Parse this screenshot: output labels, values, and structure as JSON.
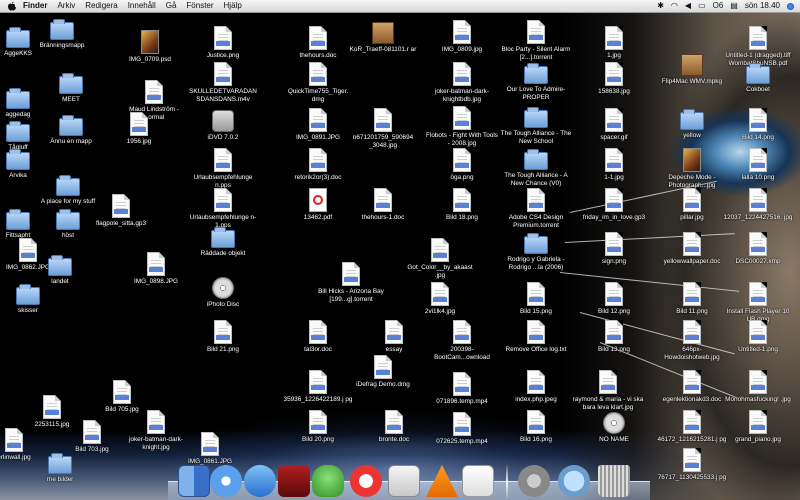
{
  "menubar": {
    "apple": "apple-icon",
    "items": [
      "Finder",
      "Arkiv",
      "Redigera",
      "Innehåll",
      "Gå",
      "Fönster",
      "Hjälp"
    ],
    "status": {
      "number": "O6",
      "clock": "sön 18.40"
    }
  },
  "icons": [
    {
      "label": "AggeKKS",
      "kind": "folder"
    },
    {
      "label": "Bränningsmapp",
      "kind": "folder"
    },
    {
      "label": "IMG_0709.psd",
      "kind": "image"
    },
    {
      "label": "aggedag",
      "kind": "folder"
    },
    {
      "label": "MEET",
      "kind": "folder"
    },
    {
      "label": "Maud Lindström - Normal",
      "kind": "document"
    },
    {
      "label": "Tågluff",
      "kind": "folder"
    },
    {
      "label": "Ännu en mapp",
      "kind": "folder"
    },
    {
      "label": "1956.jpg",
      "kind": "document"
    },
    {
      "label": "Arvika",
      "kind": "folder"
    },
    {
      "label": "A place for my stuff",
      "kind": "folder"
    },
    {
      "label": "Fittsapht",
      "kind": "folder"
    },
    {
      "label": "höst",
      "kind": "folder"
    },
    {
      "label": "flagpole_sitta.gp3",
      "kind": "document"
    },
    {
      "label": "IMG_0862.JPG",
      "kind": "document"
    },
    {
      "label": "landet",
      "kind": "folder"
    },
    {
      "label": "IMG_0898.JPG",
      "kind": "document"
    },
    {
      "label": "skisser",
      "kind": "folder"
    },
    {
      "label": "Justice.png",
      "kind": "document"
    },
    {
      "label": "SKULLEDETVARADAN SDANSDANS.m4v",
      "kind": "document"
    },
    {
      "label": "iDVD 7.0.2",
      "kind": "app"
    },
    {
      "label": "Urlaubsempfehlunge n.pps",
      "kind": "document"
    },
    {
      "label": "Urlaubsempfehlunge n-1.pps",
      "kind": "document"
    },
    {
      "label": "Räddade objekt",
      "kind": "folder"
    },
    {
      "label": "iPhoto Disc",
      "kind": "disc"
    },
    {
      "label": "Bild 21.png",
      "kind": "document"
    },
    {
      "label": "thehours.doc",
      "kind": "document"
    },
    {
      "label": "QuickTime755_Tiger. dmg",
      "kind": "document"
    },
    {
      "label": "IMG_0891.JPG",
      "kind": "document"
    },
    {
      "label": "retorik2or(3).doc",
      "kind": "document"
    },
    {
      "label": "13462.pdf",
      "kind": "pdf"
    },
    {
      "label": "KoR_Traeff-081101.r ar",
      "kind": "box"
    },
    {
      "label": "n671201759_590694 _3048.jpg",
      "kind": "document"
    },
    {
      "label": "thehours-1.doc",
      "kind": "document"
    },
    {
      "label": "Bill Hicks - Arizona Bay [199...g].torrent",
      "kind": "document"
    },
    {
      "label": "tal3or.doc",
      "kind": "document"
    },
    {
      "label": "essay",
      "kind": "document"
    },
    {
      "label": "35936_1226422189.j pg",
      "kind": "document"
    },
    {
      "label": "Bild 20.png",
      "kind": "document"
    },
    {
      "label": "IMG_0809.jpg",
      "kind": "document"
    },
    {
      "label": "joker-batman-dark- knightbdb.jpg",
      "kind": "document"
    },
    {
      "label": "Flobots - Fight With Tools - 2008.jpg",
      "kind": "document"
    },
    {
      "label": "öga.png",
      "kind": "document"
    },
    {
      "label": "Bild 18.png",
      "kind": "document"
    },
    {
      "label": "Got_Color__by_akaast .jpg",
      "kind": "document"
    },
    {
      "label": "2vi1lk4.jpg",
      "kind": "document"
    },
    {
      "label": "200398- BootCam...ownload",
      "kind": "document"
    },
    {
      "label": "iDefrag Demo.dmg",
      "kind": "document"
    },
    {
      "label": "bronte.doc",
      "kind": "document"
    },
    {
      "label": "071896.temp.mp4",
      "kind": "document"
    },
    {
      "label": "072625.temp.mp4",
      "kind": "document"
    },
    {
      "label": "Bloc Party - Silent Alarm [2...].torrent",
      "kind": "document"
    },
    {
      "label": "Our Love To Admire- PROPER",
      "kind": "folder"
    },
    {
      "label": "The Tough Alliance - The New School",
      "kind": "folder"
    },
    {
      "label": "The Tough Alliance - A New Chance (V0)",
      "kind": "folder"
    },
    {
      "label": "Adobe CS4 Design Premium.torrent",
      "kind": "document"
    },
    {
      "label": "Rodrigo y Gabriela - Rodrigo ...la (2006)",
      "kind": "folder"
    },
    {
      "label": "Bild 15.png",
      "kind": "document"
    },
    {
      "label": "Remove Office log.txt",
      "kind": "document"
    },
    {
      "label": "index.php.jpeg",
      "kind": "document"
    },
    {
      "label": "Bild 16.png",
      "kind": "document"
    },
    {
      "label": "1.jpg",
      "kind": "document"
    },
    {
      "label": "158638.jpg",
      "kind": "document"
    },
    {
      "label": "spacer.gif",
      "kind": "document"
    },
    {
      "label": "1-1.jpg",
      "kind": "document"
    },
    {
      "label": "friday_im_in_love.gp3",
      "kind": "document"
    },
    {
      "label": "sign.png",
      "kind": "document"
    },
    {
      "label": "Bild 12.png",
      "kind": "document"
    },
    {
      "label": "Bild 13.png",
      "kind": "document"
    },
    {
      "label": "raymond & maria - vi ska bara leva klart.jpg",
      "kind": "document"
    },
    {
      "label": "NO NAME",
      "kind": "disc"
    },
    {
      "label": "Flip4Mac WMV.mpkg",
      "kind": "box"
    },
    {
      "label": "yellow",
      "kind": "folder"
    },
    {
      "label": "Depeche Mode - Photograph...jpg",
      "kind": "image"
    },
    {
      "label": "pillar.jpg",
      "kind": "document"
    },
    {
      "label": "yellowwallpaper.doc",
      "kind": "document"
    },
    {
      "label": "Bild 11.png",
      "kind": "document"
    },
    {
      "label": "646px- Howdoishotweb.jpg",
      "kind": "document"
    },
    {
      "label": "egenlektionakd3.doc",
      "kind": "document"
    },
    {
      "label": "46172_1216215281.j pg",
      "kind": "document"
    },
    {
      "label": "Untitled-1 (dragged).tiff WombatShuNSB.pdf",
      "kind": "document"
    },
    {
      "label": "Cokboet",
      "kind": "folder"
    },
    {
      "label": "Bild 14.png",
      "kind": "document"
    },
    {
      "label": "lalla 10.png",
      "kind": "document"
    },
    {
      "label": "12037_1224427516. jpg",
      "kind": "document"
    },
    {
      "label": "DSC00027.xmp",
      "kind": "document"
    },
    {
      "label": "Install Flash Player 10 UB.dmg",
      "kind": "document"
    },
    {
      "label": "Untitled-1.png",
      "kind": "document"
    },
    {
      "label": "Monohmasfucking! .jpg",
      "kind": "document"
    },
    {
      "label": "grand_piano.jpg",
      "kind": "document"
    },
    {
      "label": "76717_1130425533.j pg",
      "kind": "document"
    },
    {
      "label": "2253115.jpg",
      "kind": "document"
    },
    {
      "label": "Bild 705.jpg",
      "kind": "document"
    },
    {
      "label": "joker-batman-dark- knight.jpg",
      "kind": "document"
    },
    {
      "label": "Bild 703.jpg",
      "kind": "document"
    },
    {
      "label": "IMG_0861.JPG",
      "kind": "document"
    },
    {
      "label": "erlinwall.jpg",
      "kind": "document"
    },
    {
      "label": "rne bilder",
      "kind": "folder"
    }
  ],
  "dock": {
    "items": [
      "finder-icon",
      "safari-icon",
      "itunes-icon",
      "photo-booth-icon",
      "adium-icon",
      "acrobat-cs-icon",
      "preview-icon",
      "vlc-icon",
      "textedit-icon",
      "applications-stack-icon",
      "downloads-stack-icon",
      "trash-icon"
    ]
  }
}
